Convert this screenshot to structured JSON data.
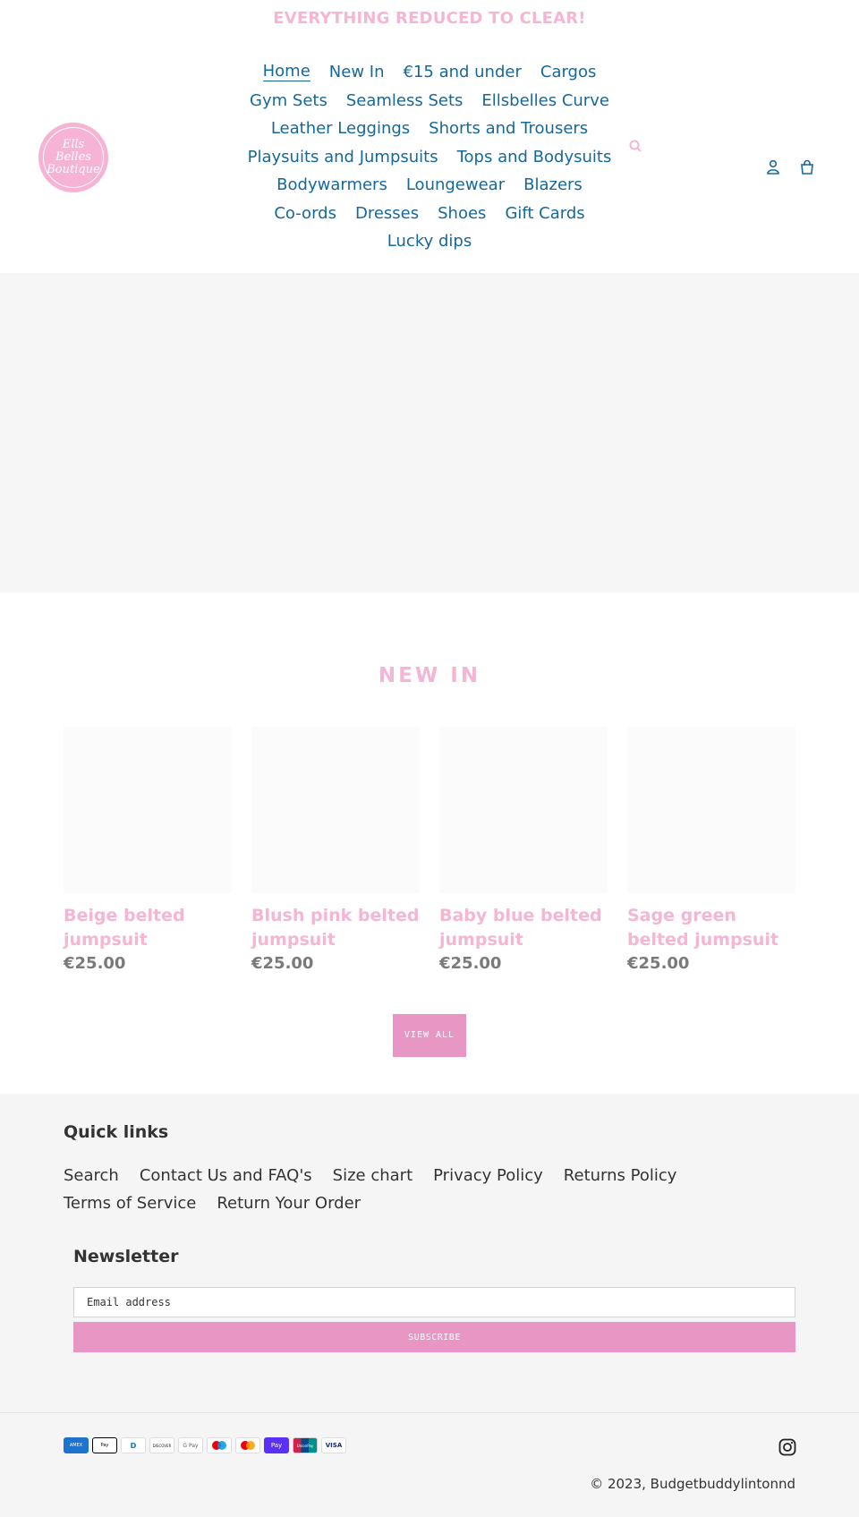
{
  "announcement": "EVERYTHING REDUCED TO CLEAR!",
  "logo": {
    "line1": "Ells",
    "line2": "Belles",
    "line3": "Boutique"
  },
  "nav": {
    "rows": [
      [
        "Home",
        "New In",
        "€15 and under",
        "Cargos"
      ],
      [
        "Gym Sets",
        "Seamless Sets",
        "Ellsbelles Curve"
      ],
      [
        "Leather Leggings",
        "Shorts and Trousers"
      ],
      [
        "Playsuits and Jumpsuits",
        "Tops and Bodysuits"
      ],
      [
        "Bodywarmers",
        "Loungewear",
        "Blazers"
      ],
      [
        "Co-ords",
        "Dresses",
        "Shoes",
        "Gift Cards"
      ],
      [
        "Lucky dips"
      ]
    ]
  },
  "icons": {
    "search": "search-icon",
    "account": "account-icon",
    "cart": "cart-icon"
  },
  "section": {
    "title": "NEW IN"
  },
  "products": [
    {
      "title": "Beige belted jumpsuit",
      "price": "€25.00"
    },
    {
      "title": "Blush pink belted jumpsuit",
      "price": "€25.00"
    },
    {
      "title": "Baby blue belted jumpsuit",
      "price": "€25.00"
    },
    {
      "title": "Sage green belted jumpsuit",
      "price": "€25.00"
    }
  ],
  "view_all": "VIEW ALL",
  "footer": {
    "quick_links_title": "Quick links",
    "quick_links_rows": [
      [
        "Search",
        "Contact Us and FAQ's",
        "Size chart",
        "Privacy Policy",
        "Returns Policy"
      ],
      [
        "Terms of Service",
        "Return Your Order"
      ]
    ],
    "newsletter_title": "Newsletter",
    "email_placeholder": "Email address",
    "subscribe": "SUBSCRIBE",
    "payments": [
      {
        "name": "amex-icon",
        "label": "AMEX",
        "color": "#1f72cd"
      },
      {
        "name": "apple-pay-icon",
        "label": "Pay",
        "color": "#ffffff"
      },
      {
        "name": "diners-club-icon",
        "label": "D",
        "color": "#ffffff"
      },
      {
        "name": "discover-icon",
        "label": "DISCOVER",
        "color": "#ffffff"
      },
      {
        "name": "google-pay-icon",
        "label": "G Pay",
        "color": "#ffffff"
      },
      {
        "name": "maestro-icon",
        "label": "",
        "color": "#ffffff"
      },
      {
        "name": "mastercard-icon",
        "label": "",
        "color": "#ffffff"
      },
      {
        "name": "shop-pay-icon",
        "label": "Pay",
        "color": "#5a31f4"
      },
      {
        "name": "union-pay-icon",
        "label": "UnionPay",
        "color": "#d0234a"
      },
      {
        "name": "visa-icon",
        "label": "VISA",
        "color": "#ffffff"
      }
    ],
    "copyright": "© 2023, Budgetbuddylintonnd"
  },
  "colors": {
    "nav": "#16689c",
    "accent_pink": "#f4b6d4",
    "button_pink": "#e896c4"
  }
}
